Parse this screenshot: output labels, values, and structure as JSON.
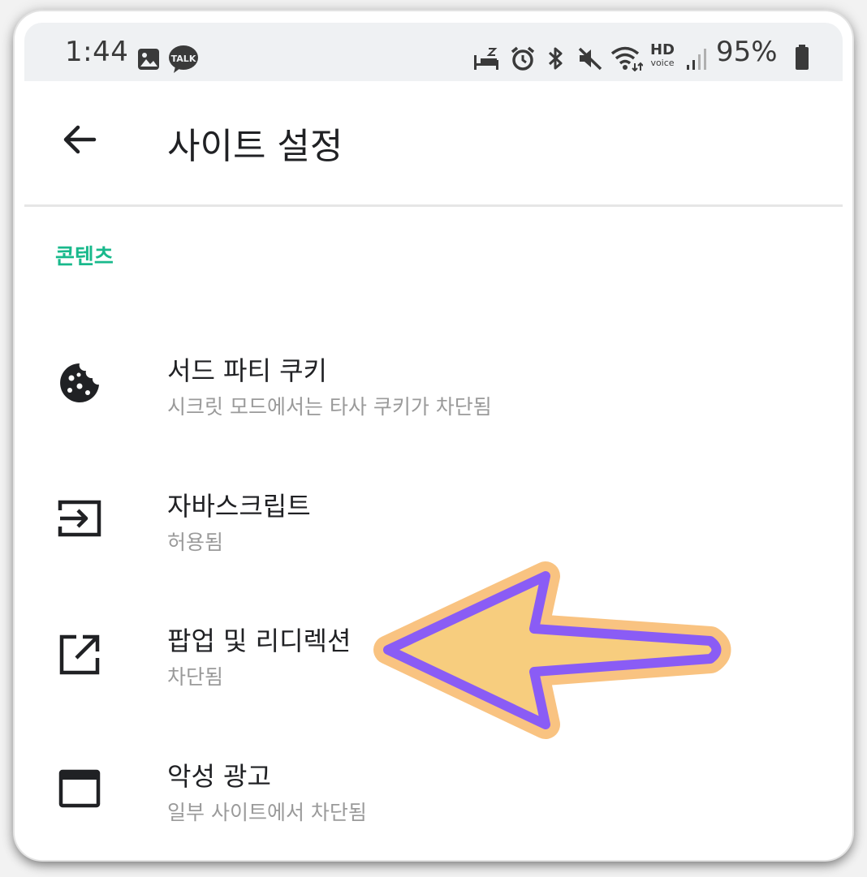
{
  "status_bar": {
    "time": "1:44",
    "talk_badge": "TALK",
    "hd_label": "HD",
    "voice_label": "voice",
    "battery_percent": "95%",
    "icons": [
      "gallery-icon",
      "kakaotalk-icon",
      "sleep-mode-icon",
      "alarm-icon",
      "bluetooth-icon",
      "mute-icon",
      "wifi-icon",
      "hd-voice-icon",
      "signal-icon",
      "battery-icon"
    ]
  },
  "app_bar": {
    "title": "사이트 설정",
    "back_icon": "arrow-back-icon"
  },
  "section": {
    "header": "콘텐츠",
    "accent_color": "#19b98c"
  },
  "settings": [
    {
      "title": "서드 파티 쿠키",
      "subtitle": "시크릿 모드에서는 타사 쿠키가 차단됨",
      "icon": "cookie-icon"
    },
    {
      "title": "자바스크립트",
      "subtitle": "허용됨",
      "icon": "javascript-input-icon"
    },
    {
      "title": "팝업 및 리디렉션",
      "subtitle": "차단됨",
      "icon": "open-in-new-icon"
    },
    {
      "title": "악성 광고",
      "subtitle": "일부 사이트에서 차단됨",
      "icon": "window-icon"
    }
  ],
  "annotation": {
    "type": "arrow",
    "fill_color": "#f7cd7e",
    "outline_color": "#8a5cf5",
    "glow_color": "#f9c07a",
    "points_to": "팝업 및 리디렉션"
  }
}
